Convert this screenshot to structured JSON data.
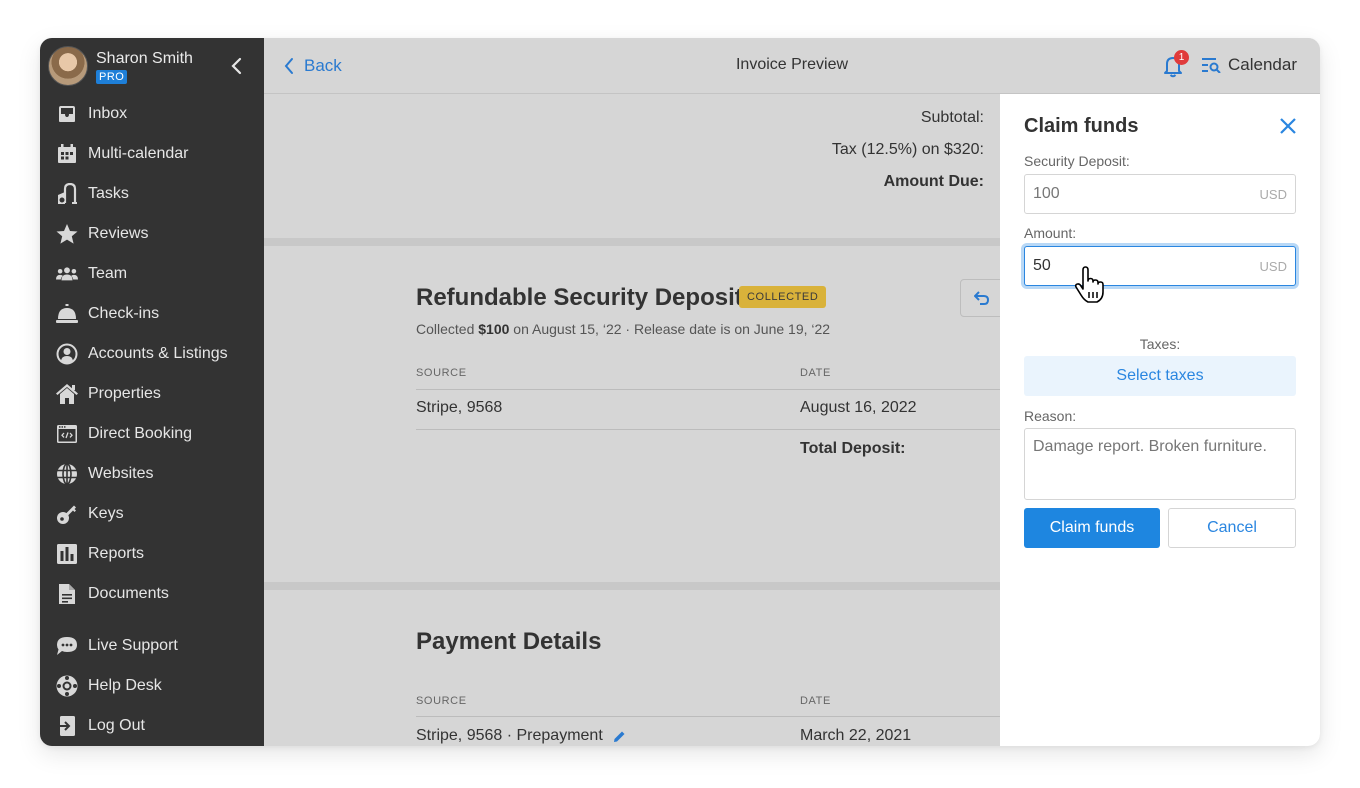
{
  "user": {
    "name": "Sharon Smith",
    "plan_badge": "PRO"
  },
  "sidebar": {
    "items": [
      {
        "label": "Inbox",
        "icon": "inbox-icon"
      },
      {
        "label": "Multi-calendar",
        "icon": "calendar-grid-icon"
      },
      {
        "label": "Tasks",
        "icon": "vacuum-icon"
      },
      {
        "label": "Reviews",
        "icon": "star-icon"
      },
      {
        "label": "Team",
        "icon": "team-icon"
      },
      {
        "label": "Check-ins",
        "icon": "bell-desk-icon"
      },
      {
        "label": "Accounts & Listings",
        "icon": "user-circle-icon"
      },
      {
        "label": "Properties",
        "icon": "home-icon"
      },
      {
        "label": "Direct Booking",
        "icon": "code-window-icon"
      },
      {
        "label": "Websites",
        "icon": "globe-icon"
      },
      {
        "label": "Keys",
        "icon": "key-icon"
      },
      {
        "label": "Reports",
        "icon": "bar-chart-icon"
      },
      {
        "label": "Documents",
        "icon": "document-icon"
      }
    ],
    "bottom_items": [
      {
        "label": "Live Support",
        "icon": "chat-icon"
      },
      {
        "label": "Help Desk",
        "icon": "lifebuoy-icon"
      },
      {
        "label": "Log Out",
        "icon": "logout-icon"
      }
    ]
  },
  "topbar": {
    "back_label": "Back",
    "title": "Invoice Preview",
    "notification_count": "1",
    "calendar_label": "Calendar"
  },
  "totals": {
    "subtotal_label": "Subtotal:",
    "tax_label": "Tax (12.5%) on $320:",
    "amount_due_label": "Amount Due:"
  },
  "deposit": {
    "title": "Refundable Security Deposit",
    "status": "COLLECTED",
    "sub_prefix": "Collected ",
    "sub_amount": "$100",
    "sub_suffix": " on August 15, ‘22 · Release date is on June 19, ‘22",
    "columns": [
      "SOURCE",
      "DATE"
    ],
    "rows": [
      {
        "source": "Stripe, 9568",
        "date": "August 16, 2022"
      }
    ],
    "total_label": "Total Deposit:"
  },
  "payment": {
    "title": "Payment Details",
    "columns": [
      "SOURCE",
      "DATE"
    ],
    "rows": [
      {
        "source": "Stripe, 9568 · Prepayment",
        "date": "March 22, 2021"
      }
    ]
  },
  "claim_panel": {
    "title": "Claim funds",
    "security_deposit_label": "Security Deposit:",
    "security_deposit_value": "100",
    "currency": "USD",
    "amount_label": "Amount:",
    "amount_value": "50",
    "taxes_label": "Taxes:",
    "select_taxes_label": "Select taxes",
    "reason_label": "Reason:",
    "reason_value": "Damage report. Broken furniture.",
    "submit_label": "Claim funds",
    "cancel_label": "Cancel"
  },
  "colors": {
    "accent": "#1e86e0",
    "sidebar_bg": "#333333",
    "badge_collected": "#d9b23a",
    "notification": "#e03b3b"
  }
}
